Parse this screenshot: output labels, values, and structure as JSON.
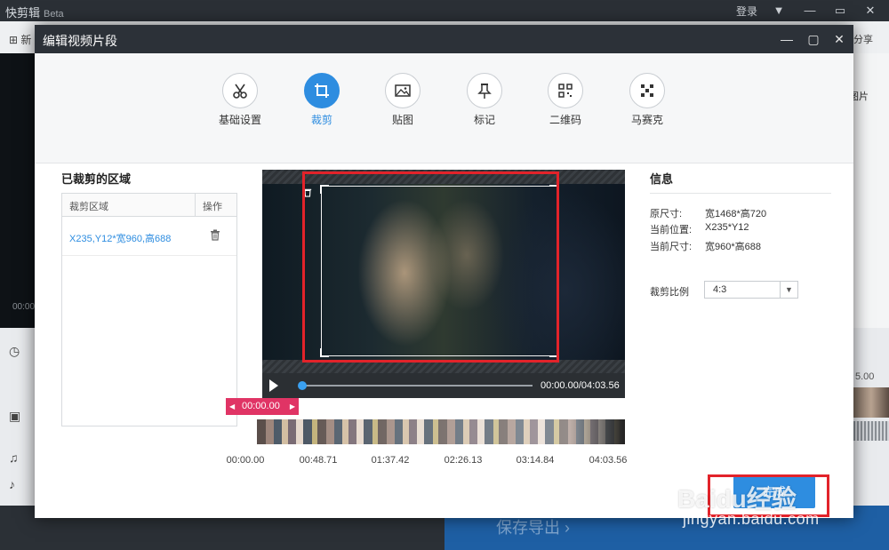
{
  "app": {
    "logo": "快剪辑",
    "beta": "Beta",
    "login": "登录",
    "new_label": "新",
    "share_label": "分享",
    "pic_btn": "图片",
    "time_left": "00:00",
    "time_right": "5.00",
    "save_export": "保存导出"
  },
  "modal": {
    "title": "编辑视频片段"
  },
  "tabs": [
    {
      "label": "基础设置",
      "icon": "scissors-icon"
    },
    {
      "label": "裁剪",
      "icon": "crop-icon"
    },
    {
      "label": "贴图",
      "icon": "image-icon"
    },
    {
      "label": "标记",
      "icon": "pin-icon"
    },
    {
      "label": "二维码",
      "icon": "qrcode-icon"
    },
    {
      "label": "马赛克",
      "icon": "mosaic-icon"
    }
  ],
  "active_tab": "裁剪",
  "cropped": {
    "title": "已裁剪的区域",
    "col_area": "裁剪区域",
    "col_op": "操作",
    "rows": [
      {
        "area": "X235,Y12*宽960,高688"
      }
    ]
  },
  "player": {
    "time": "00:00.00/04:03.56",
    "marker": "00:00.00",
    "ruler": [
      "00:00.00",
      "00:48.71",
      "01:37.42",
      "02:26.13",
      "03:14.84",
      "04:03.56"
    ]
  },
  "info": {
    "title": "信息",
    "rows": [
      {
        "label": "原尺寸:",
        "value": "宽1468*高720"
      },
      {
        "label": "当前位置:",
        "value": "X235*Y12"
      },
      {
        "label": "当前尺寸:",
        "value": "宽960*高688"
      }
    ],
    "ratio_label": "裁剪比例",
    "ratio_value": "4:3"
  },
  "finish_label": "完成",
  "watermark": {
    "text": "Baidu经验",
    "url": "jingyan.baidu.com"
  },
  "colors": {
    "accent": "#2e8de0",
    "highlight": "#e2232a",
    "marker": "#e03465"
  }
}
